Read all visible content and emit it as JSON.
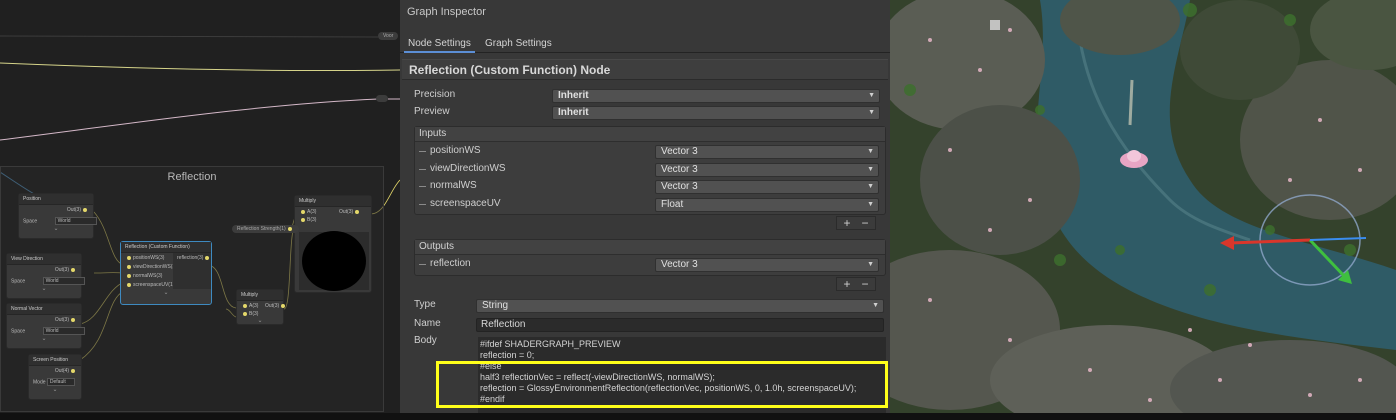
{
  "graph": {
    "group_title": "Reflection",
    "top_pill": "Voor",
    "node_position": {
      "title": "Position",
      "out": "Out(3)",
      "space_label": "Space",
      "space_value": "World"
    },
    "node_view_direction": {
      "title": "View Direction",
      "out": "Out(3)",
      "space_label": "Space",
      "space_value": "World"
    },
    "node_normal_vector": {
      "title": "Normal Vector",
      "out": "Out(3)",
      "space_label": "Space",
      "space_value": "World"
    },
    "node_screen_position": {
      "title": "Screen Position",
      "out": "Out(4)",
      "mode_label": "Mode",
      "mode_value": "Default"
    },
    "node_reflection": {
      "title": "Reflection (Custom Function)",
      "inputs": [
        "positionWS(3)",
        "viewDirectionWS(3)",
        "normalWS(3)",
        "screenspaceUV(1)"
      ],
      "output": "reflection(3)"
    },
    "node_multiply_small": {
      "title": "Multiply",
      "a": "A(3)",
      "b": "B(3)",
      "out": "Out(3)"
    },
    "node_multiply_big": {
      "title": "Multiply",
      "a": "A(3)",
      "b": "B(3)",
      "out": "Out(3)"
    },
    "pill_reflection_strength": "Reflection Strength(1)"
  },
  "inspector": {
    "title": "Graph Inspector",
    "tabs": [
      "Node Settings",
      "Graph Settings"
    ],
    "node_title": "Reflection (Custom Function) Node",
    "precision": {
      "label": "Precision",
      "value": "Inherit"
    },
    "preview": {
      "label": "Preview",
      "value": "Inherit"
    },
    "inputs": {
      "header": "Inputs",
      "rows": [
        {
          "name": "positionWS",
          "type": "Vector 3"
        },
        {
          "name": "viewDirectionWS",
          "type": "Vector 3"
        },
        {
          "name": "normalWS",
          "type": "Vector 3"
        },
        {
          "name": "screenspaceUV",
          "type": "Float"
        }
      ]
    },
    "outputs": {
      "header": "Outputs",
      "rows": [
        {
          "name": "reflection",
          "type": "Vector 3"
        }
      ]
    },
    "add_label": "+",
    "remove_label": "−",
    "type": {
      "label": "Type",
      "value": "String"
    },
    "name": {
      "label": "Name",
      "value": "Reflection"
    },
    "body": {
      "label": "Body",
      "lines": [
        "#ifdef SHADERGRAPH_PREVIEW",
        "reflection = 0;",
        "#else",
        "half3 reflectionVec = reflect(-viewDirectionWS, normalWS);",
        "reflection = GlossyEnvironmentReflection(reflectionVec, positionWS, 0, 1.0h, screenspaceUV);",
        "#endif"
      ]
    },
    "highlight_color": "#ffff1a"
  },
  "scene": {
    "water_color": "#2f5b66",
    "gizmo_colors": {
      "x": "#d9362b",
      "y": "#3a8df0",
      "z": "#3fbf3f"
    }
  }
}
